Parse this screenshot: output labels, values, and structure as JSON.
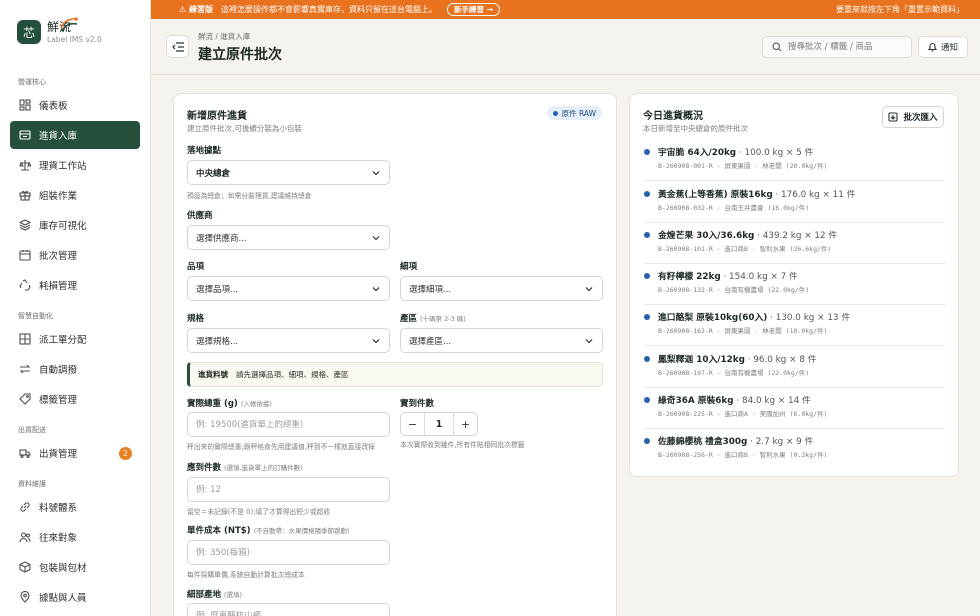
{
  "brand": {
    "logo_char": "芯",
    "name": "鮮流",
    "sub": "Label IMS v2.0"
  },
  "sidebar": {
    "sections": [
      "營運核心",
      "智慧自動化",
      "出貨配送",
      "資料維護"
    ],
    "items": [
      {
        "label": "儀表板",
        "icon": "dashboard-icon"
      },
      {
        "label": "進貨入庫",
        "icon": "inbound-icon",
        "active": true
      },
      {
        "label": "理貨工作站",
        "icon": "scale-icon"
      },
      {
        "label": "組裝作業",
        "icon": "gift-box-icon"
      },
      {
        "label": "庫存可視化",
        "icon": "layers-icon"
      },
      {
        "label": "批次管理",
        "icon": "calendar-icon"
      },
      {
        "label": "耗損管理",
        "icon": "recycle-icon"
      },
      {
        "label": "派工單分配",
        "icon": "table-grid-icon"
      },
      {
        "label": "自動調撥",
        "icon": "transfer-arrows-icon"
      },
      {
        "label": "標籤管理",
        "icon": "tag-icon"
      },
      {
        "label": "出貨管理",
        "icon": "truck-icon",
        "badge": "2"
      },
      {
        "label": "料號體系",
        "icon": "link-icon"
      },
      {
        "label": "往來對象",
        "icon": "users-icon"
      },
      {
        "label": "包裝與包材",
        "icon": "package-icon"
      },
      {
        "label": "據點與人員",
        "icon": "location-pin-icon"
      }
    ]
  },
  "banner": {
    "warn": "練習版",
    "message": "這裡怎麼操作都不會影響真實庫存，資料只留在這台電腦上。",
    "tour_button": "新手練習 →",
    "right_text": "要重來就按左下角「重置示範資料」"
  },
  "header": {
    "breadcrumb": "鮮流 / 進貨入庫",
    "title": "建立原件批次",
    "search_placeholder": "搜尋批次 / 標籤 / 商品",
    "notify_label": "通知"
  },
  "form": {
    "title": "新增原件進貨",
    "subtitle": "建立原件批次,可後續分裝為小包裝",
    "raw_tag": "原件 RAW",
    "site_label": "落地據點",
    "site_value": "中央總倉",
    "site_help": "預設為總倉；如需分裝理貨,建議維持總倉",
    "supplier_label": "供應商",
    "supplier_placeholder": "選擇供應商...",
    "item_label": "品項",
    "item_placeholder": "選擇品項...",
    "subitem_label": "細項",
    "subitem_placeholder": "選擇細項...",
    "spec_label": "規格",
    "spec_placeholder": "選擇規格...",
    "origin_label": "產區",
    "origin_hint": "(十碼第 2-3 碼)",
    "origin_placeholder": "選擇產區...",
    "notice_title": "進貨料號",
    "notice_text": "請先選擇品項、細項、規格、產區",
    "weight_label": "實際總重 (g)",
    "weight_hint": "(入帳依據)",
    "weight_placeholder": "例: 19500(進貨單上的總重)",
    "weight_help": "秤出來的實際總重;跟秤格食先用建議值,秤到不一樣就直接改掉",
    "qty_label": "實到件數",
    "qty_value": "1",
    "qty_help": "本次實際收到幾件,所有件貼相同批次標籤",
    "expected_label": "應到件數",
    "expected_hint": "(選填,進貨單上的訂購件數)",
    "expected_placeholder": "例: 12",
    "expected_help": "留空＝未記錄(不是 0);填了才算得出短少或超收",
    "cost_label": "單件成本 (NT$)",
    "cost_hint": "(不自動帶：水果價格隨季節跳動)",
    "cost_placeholder": "例: 350(每箱)",
    "cost_help": "每件採購單價,系統自動計算批次總成本",
    "detail_label": "細部產地",
    "detail_hint": "(選填)",
    "detail_placeholder": "例: 屏東縣枋山鄉"
  },
  "summary": {
    "title": "今日進貨概況",
    "subtitle": "本日新增至中央總倉的原件批次",
    "import_button": "批次匯入",
    "entries": [
      {
        "name": "宇宙脆 64入/20kg",
        "meta": "· 100.0 kg × 5 件",
        "code": "B-260908-001-R · 屏東果園 · 林老闆 (20.0kg/件)"
      },
      {
        "name": "黃金蕉(上等香蕉) 原裝16kg",
        "meta": "· 176.0 kg × 11 件",
        "code": "B-260908-032-R · 台南玉井農會 (16.0kg/件)"
      },
      {
        "name": "金煌芒果 30入/36.6kg",
        "meta": "· 439.2 kg × 12 件",
        "code": "B-260908-101-R · 進口商B · 智利水果 (36.6kg/件)"
      },
      {
        "name": "有籽檸檬 22kg",
        "meta": "· 154.0 kg × 7 件",
        "code": "B-260908-132-R · 台南有機農場 (22.0kg/件)"
      },
      {
        "name": "進口酪梨 原裝10kg(60入)",
        "meta": "· 130.0 kg × 13 件",
        "code": "B-260908-162-R · 屏東果園 · 林老闆 (10.0kg/件)"
      },
      {
        "name": "鳳梨釋迦 10入/12kg",
        "meta": "· 96.0 kg × 8 件",
        "code": "B-260908-197-R · 台南有機農場 (22.0kg/件)"
      },
      {
        "name": "綠奇36A 原裝6kg",
        "meta": "· 84.0 kg × 14 件",
        "code": "B-260908-225-R · 進口商A · 美國加州 (6.0kg/件)"
      },
      {
        "name": "佐藤錦櫻桃 禮盒300g",
        "meta": "· 2.7 kg × 9 件",
        "code": "B-260908-256-R · 進口商B · 智利水果 (0.3kg/件)"
      }
    ]
  }
}
